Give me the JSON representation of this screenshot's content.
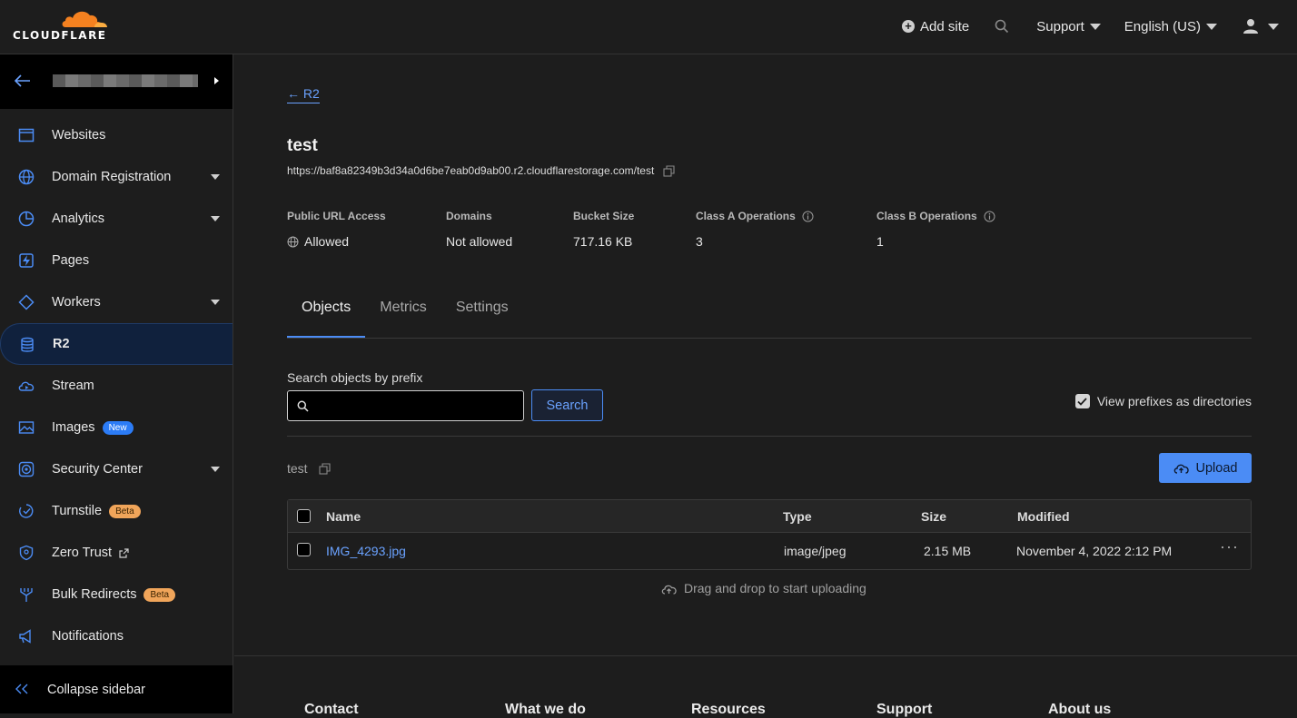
{
  "brand": {
    "wordmark": "CLOUDFLARE",
    "accent": "#f48120"
  },
  "topbar": {
    "add_site": "Add site",
    "support": "Support",
    "language": "English (US)"
  },
  "sidebar": {
    "items": [
      {
        "label": "Websites",
        "icon": "browser-window-icon"
      },
      {
        "label": "Domain Registration",
        "icon": "globe-icon"
      },
      {
        "label": "Analytics",
        "icon": "pie-chart-icon"
      },
      {
        "label": "Pages",
        "icon": "lightning-icon"
      },
      {
        "label": "Workers",
        "icon": "diamond-icon"
      },
      {
        "label": "R2",
        "icon": "database-icon"
      },
      {
        "label": "Stream",
        "icon": "cloud-play-icon"
      },
      {
        "label": "Images",
        "icon": "image-icon",
        "badge": "New"
      },
      {
        "label": "Security Center",
        "icon": "security-icon"
      },
      {
        "label": "Turnstile",
        "icon": "turnstile-icon",
        "badge": "Beta"
      },
      {
        "label": "Zero Trust",
        "icon": "shield-icon"
      },
      {
        "label": "Bulk Redirects",
        "icon": "redirect-icon",
        "badge": "Beta"
      },
      {
        "label": "Notifications",
        "icon": "megaphone-icon"
      }
    ],
    "collapse": "Collapse sidebar"
  },
  "bucket": {
    "back_label": "R2",
    "name": "test",
    "url": "https://baf8a82349b3d34a0d6be7eab0d9ab00.r2.cloudflarestorage.com/test",
    "stats": {
      "public_url_access": {
        "label": "Public URL Access",
        "value": "Allowed"
      },
      "domains": {
        "label": "Domains",
        "value": "Not allowed"
      },
      "bucket_size": {
        "label": "Bucket Size",
        "value": "717.16 KB"
      },
      "class_a": {
        "label": "Class A Operations",
        "value": "3"
      },
      "class_b": {
        "label": "Class B Operations",
        "value": "1"
      }
    }
  },
  "tabs": [
    "Objects",
    "Metrics",
    "Settings"
  ],
  "search": {
    "label": "Search objects by prefix",
    "value": "",
    "button": "Search",
    "prefix_toggle": "View prefixes as directories"
  },
  "path": "test",
  "upload": "Upload",
  "table": {
    "columns": [
      "Name",
      "Type",
      "Size",
      "Modified"
    ],
    "rows": [
      {
        "name": "IMG_4293.jpg",
        "type": "image/jpeg",
        "size": "2.15 MB",
        "modified": "November 4, 2022 2:12 PM"
      }
    ]
  },
  "dropzone": "Drag and drop to start uploading",
  "footer": [
    "Contact",
    "What we do",
    "Resources",
    "Support",
    "About us"
  ]
}
